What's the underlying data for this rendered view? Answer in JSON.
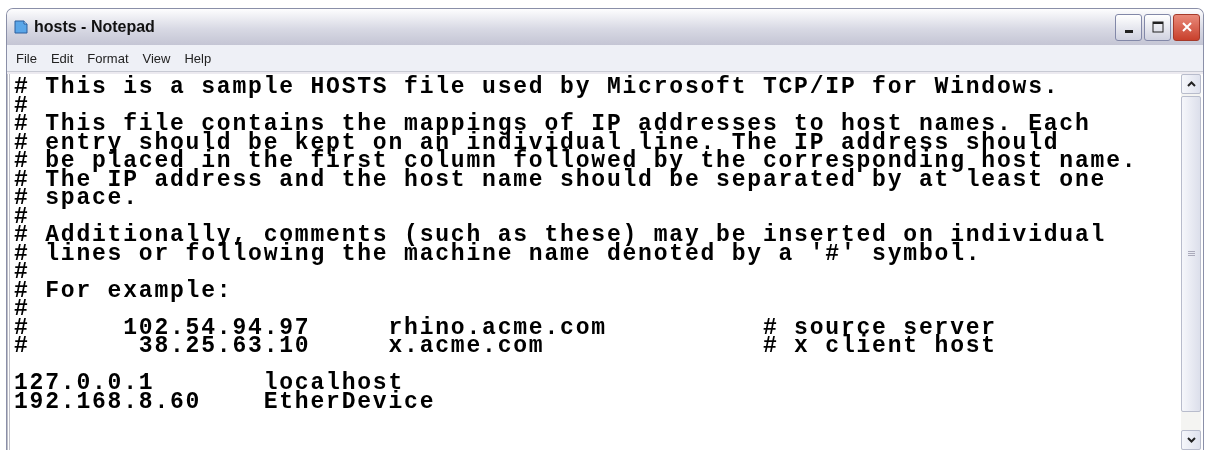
{
  "window": {
    "title": "hosts - Notepad"
  },
  "menu": [
    "File",
    "Edit",
    "Format",
    "View",
    "Help"
  ],
  "comment_lines": [
    "# This is a sample HOSTS file used by Microsoft TCP/IP for Windows.",
    "#",
    "# This file contains the mappings of IP addresses to host names. Each",
    "# entry should be kept on an individual line. The IP address should",
    "# be placed in the first column followed by the corresponding host name.",
    "# The IP address and the host name should be separated by at least one",
    "# space.",
    "#",
    "# Additionally, comments (such as these) may be inserted on individual",
    "# lines or following the machine name denoted by a '#' symbol.",
    "#",
    "# For example:",
    "#",
    "#      102.54.94.97     rhino.acme.com          # source server",
    "#       38.25.63.10     x.acme.com              # x client host"
  ],
  "host_lines": [
    "127.0.0.1       localhost",
    "192.168.8.60    EtherDevice"
  ]
}
